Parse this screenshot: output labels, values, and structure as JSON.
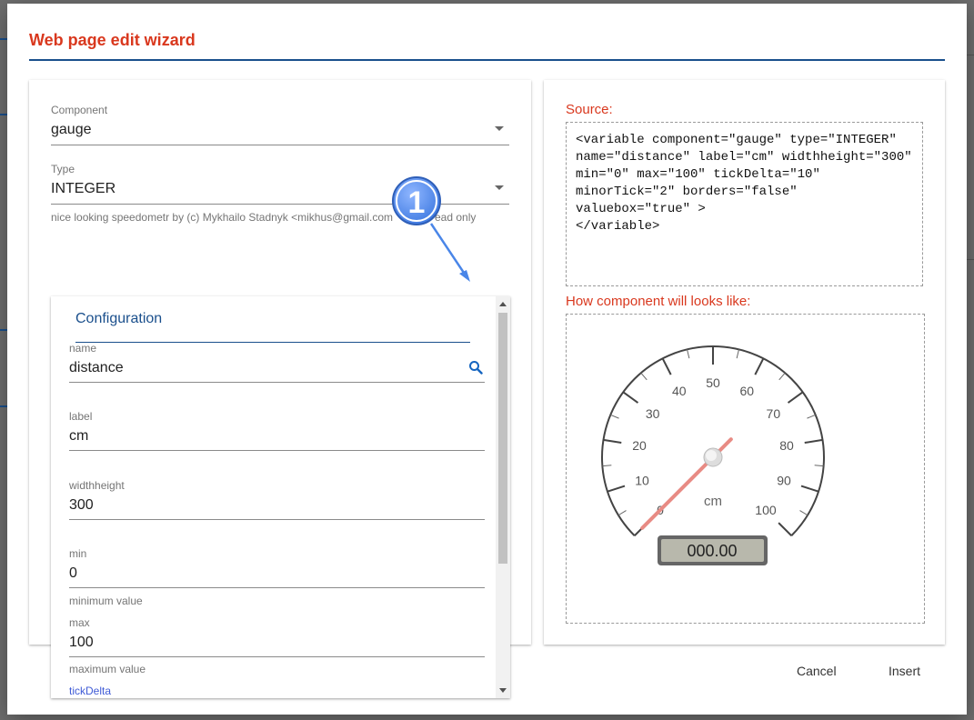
{
  "dialog": {
    "title": "Web page edit wizard",
    "cancel_label": "Cancel",
    "insert_label": "Insert"
  },
  "left": {
    "component": {
      "label": "Component",
      "value": "gauge"
    },
    "type": {
      "label": "Type",
      "value": "INTEGER"
    },
    "description": "nice looking speedometr by (c) Mykhailo Stadnyk <mikhus@gmail.com",
    "description_tail": "ead only",
    "config": {
      "tab_label": "Configuration",
      "fields": [
        {
          "label": "name",
          "value": "distance"
        },
        {
          "label": "label",
          "value": "cm"
        },
        {
          "label": "widthheight",
          "value": "300"
        },
        {
          "label": "min",
          "value": "0",
          "helper": "minimum value"
        },
        {
          "label": "max",
          "value": "100",
          "helper": "maximum value"
        }
      ],
      "next_field_label": "tickDelta"
    }
  },
  "right": {
    "source_heading": "Source:",
    "source_code": "<variable component=\"gauge\" type=\"INTEGER\" name=\"distance\" label=\"cm\" widthheight=\"300\" min=\"0\" max=\"100\" tickDelta=\"10\" minorTick=\"2\" borders=\"false\" valuebox=\"true\" >\n</variable>",
    "preview_heading": "How component will looks like:"
  },
  "gauge": {
    "min": 0,
    "max": 100,
    "value": 0,
    "tick_labels": [
      "0",
      "10",
      "20",
      "30",
      "40",
      "50",
      "60",
      "70",
      "80",
      "90",
      "100"
    ],
    "units": "cm",
    "value_box": "000.00",
    "needle_color": "#e88b84"
  },
  "annotation": {
    "number": "1",
    "color": "#4a86e8"
  },
  "icons": {
    "search": "search-icon",
    "dropdown": "chevron-down-icon"
  },
  "colors": {
    "accent": "#1a4f8c",
    "heading": "#d9381e",
    "link": "#3f5bd6"
  }
}
